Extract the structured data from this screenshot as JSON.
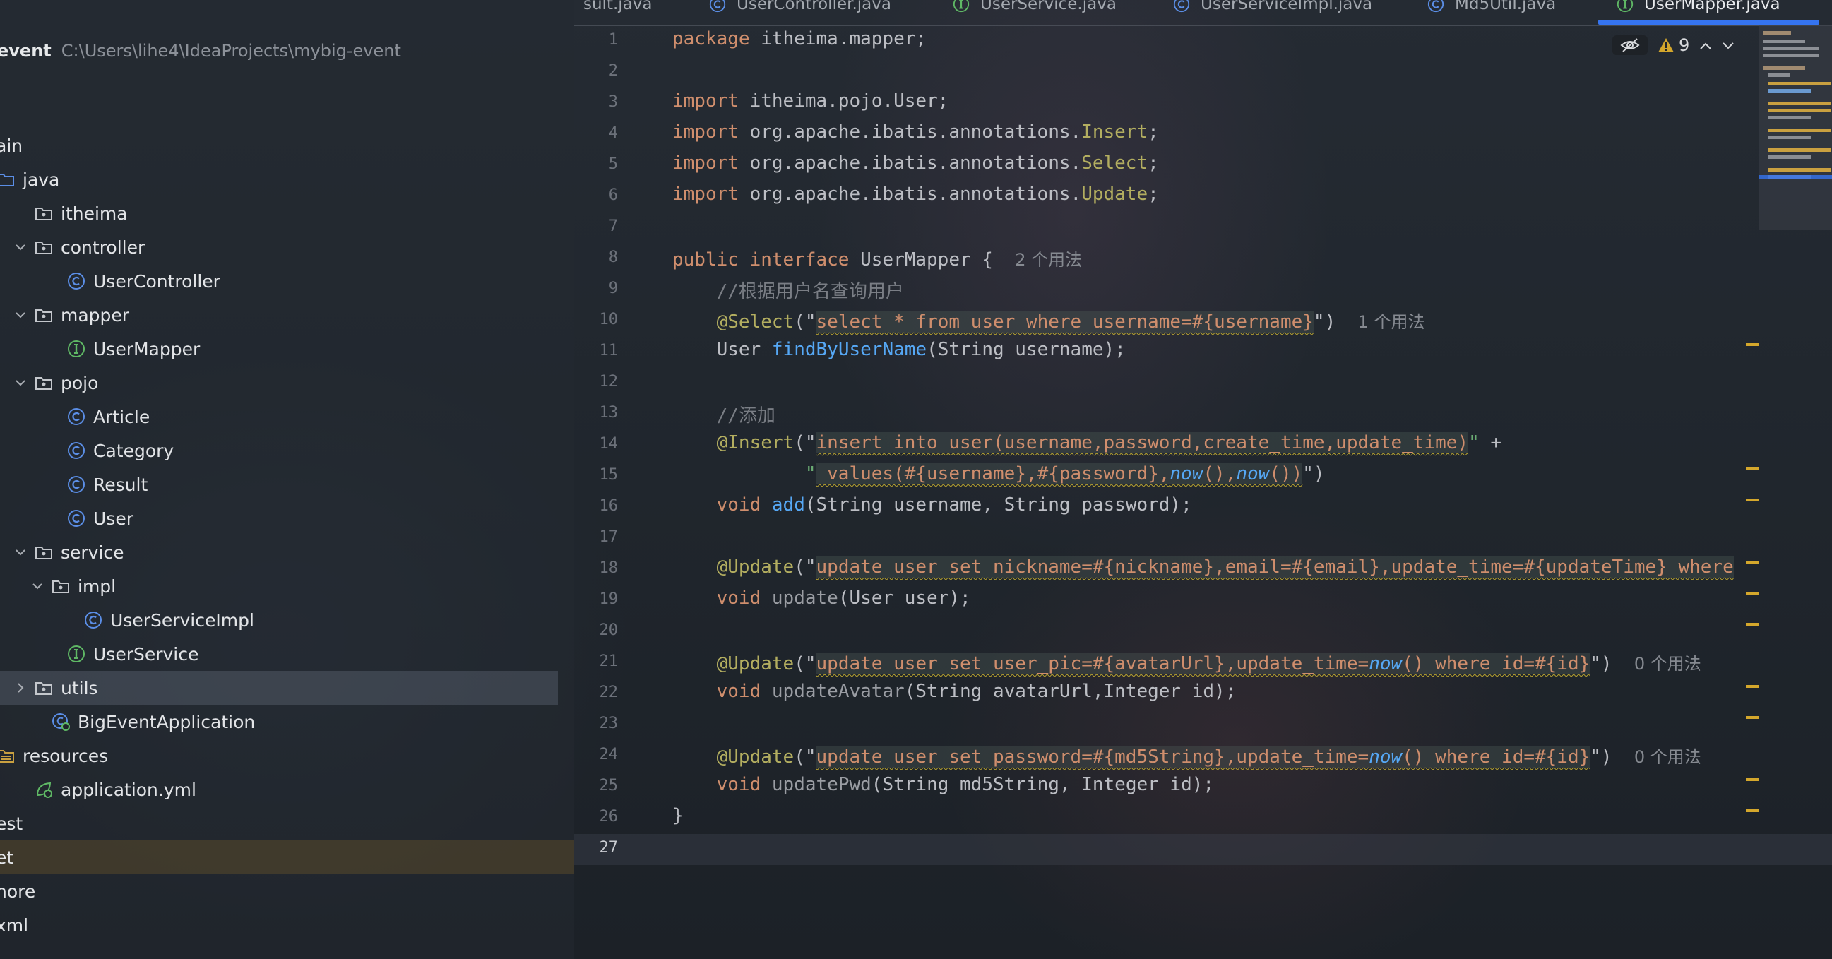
{
  "project": {
    "name": "event",
    "path": "C:\\Users\\lihe4\\IdeaProjects\\mybig-event",
    "tree": [
      {
        "label": "ain",
        "icon": "none",
        "chevron": "none"
      },
      {
        "label": "java",
        "icon": "source-folder-icon",
        "chevron": "none"
      },
      {
        "label": "itheima",
        "icon": "package-icon",
        "chevron": "none"
      },
      {
        "label": "controller",
        "icon": "package-icon",
        "chevron": "expanded"
      },
      {
        "label": "UserController",
        "icon": "class-icon",
        "chevron": "none"
      },
      {
        "label": "mapper",
        "icon": "package-icon",
        "chevron": "expanded"
      },
      {
        "label": "UserMapper",
        "icon": "interface-icon",
        "chevron": "none"
      },
      {
        "label": "pojo",
        "icon": "package-icon",
        "chevron": "expanded"
      },
      {
        "label": "Article",
        "icon": "class-icon",
        "chevron": "none"
      },
      {
        "label": "Category",
        "icon": "class-icon",
        "chevron": "none"
      },
      {
        "label": "Result",
        "icon": "class-icon",
        "chevron": "none"
      },
      {
        "label": "User",
        "icon": "class-icon",
        "chevron": "none"
      },
      {
        "label": "service",
        "icon": "package-icon",
        "chevron": "expanded"
      },
      {
        "label": "impl",
        "icon": "package-icon",
        "chevron": "expanded"
      },
      {
        "label": "UserServiceImpl",
        "icon": "class-icon",
        "chevron": "none"
      },
      {
        "label": "UserService",
        "icon": "interface-icon",
        "chevron": "none"
      },
      {
        "label": "utils",
        "icon": "package-icon",
        "chevron": "collapsed"
      },
      {
        "label": "BigEventApplication",
        "icon": "spring-boot-class-icon",
        "chevron": "none"
      },
      {
        "label": "resources",
        "icon": "resources-folder-icon",
        "chevron": "none"
      },
      {
        "label": "application.yml",
        "icon": "spring-config-icon",
        "chevron": "none"
      },
      {
        "label": "est",
        "icon": "none",
        "chevron": "none"
      },
      {
        "label": "et",
        "icon": "none",
        "chevron": "none"
      },
      {
        "label": "nore",
        "icon": "none",
        "chevron": "none"
      },
      {
        "label": "xml",
        "icon": "none",
        "chevron": "none"
      }
    ]
  },
  "tabs": [
    {
      "label": "sult.java",
      "icon": "none"
    },
    {
      "label": "UserController.java",
      "icon": "class-icon"
    },
    {
      "label": "UserService.java",
      "icon": "interface-icon"
    },
    {
      "label": "UserServiceImpl.java",
      "icon": "class-icon"
    },
    {
      "label": "Md5Util.java",
      "icon": "class-icon"
    },
    {
      "label": "UserMapper.java",
      "icon": "interface-icon",
      "active": true
    }
  ],
  "inspections": {
    "warnings": "9"
  },
  "editor": {
    "line_numbers": [
      "1",
      "2",
      "3",
      "4",
      "5",
      "6",
      "7",
      "8",
      "9",
      "10",
      "11",
      "12",
      "13",
      "14",
      "15",
      "16",
      "17",
      "18",
      "19",
      "20",
      "21",
      "22",
      "23",
      "24",
      "25",
      "26",
      "27"
    ],
    "hints": {
      "usages_2": "2 个用法",
      "usages_1": "1 个用法",
      "usages_0a": "0 个用法",
      "usages_0b": "0 个用法"
    },
    "lines": {
      "l1_kw": "package",
      "l1_rest": " itheima.mapper;",
      "l3_kw": "import",
      "l3_rest": " itheima.pojo.User;",
      "l4_kw": "import",
      "l4_pkg": " org.apache.ibatis.annotations.",
      "l4_ann": "Insert",
      "l5_kw": "import",
      "l5_pkg": " org.apache.ibatis.annotations.",
      "l5_ann": "Select",
      "l6_kw": "import",
      "l6_pkg": " org.apache.ibatis.annotations.",
      "l6_ann": "Update",
      "l8_kw": "public interface",
      "l8_rest": " UserMapper {",
      "l9_cmt": "//根据用户名查询用户",
      "l10_ann": "@Select",
      "l10_sql": "select * from user where username=#{username}",
      "l11_type": "User ",
      "l11_mth": "findByUserName",
      "l11_rest": "(String username);",
      "l13_cmt": "//添加",
      "l14_ann": "@Insert",
      "l14_sql": "insert into user(username,password,create_time,update_time)",
      "l14_plus": " +",
      "l15_sql_a": " values(#{username},#{password},",
      "l15_fn1": "now",
      "l15_mid": "(),",
      "l15_fn2": "now",
      "l15_end": "())",
      "l16_kw": "void ",
      "l16_mth": "add",
      "l16_rest": "(String username, String password);",
      "l18_ann": "@Update",
      "l18_sql": "update user set nickname=#{nickname},email=#{email},update_time=#{updateTime} where",
      "l19_kw": "void ",
      "l19_mth": "update",
      "l19_rest": "(User user);",
      "l21_ann": "@Update",
      "l21_sql_a": "update user set user_pic=#{avatarUrl},update_time=",
      "l21_fn": "now",
      "l21_sql_b": "() where id=#{id}",
      "l22_kw": "void ",
      "l22_mth": "updateAvatar",
      "l22_rest": "(String avatarUrl,Integer id);",
      "l24_ann": "@Update",
      "l24_sql_a": "update user set password=#{md5String},update_time=",
      "l24_fn": "now",
      "l24_sql_b": "() where id=#{id}",
      "l25_kw": "void ",
      "l25_mth": "updatePwd",
      "l25_rest": "(String md5String, Integer id);",
      "l26": "}"
    }
  },
  "colors": {
    "accent": "#3574f0",
    "keyword": "#cf8e6d",
    "annotation": "#b3ae60",
    "string": "#6aab73",
    "method": "#56a8f5",
    "warning": "#d4a72c"
  }
}
